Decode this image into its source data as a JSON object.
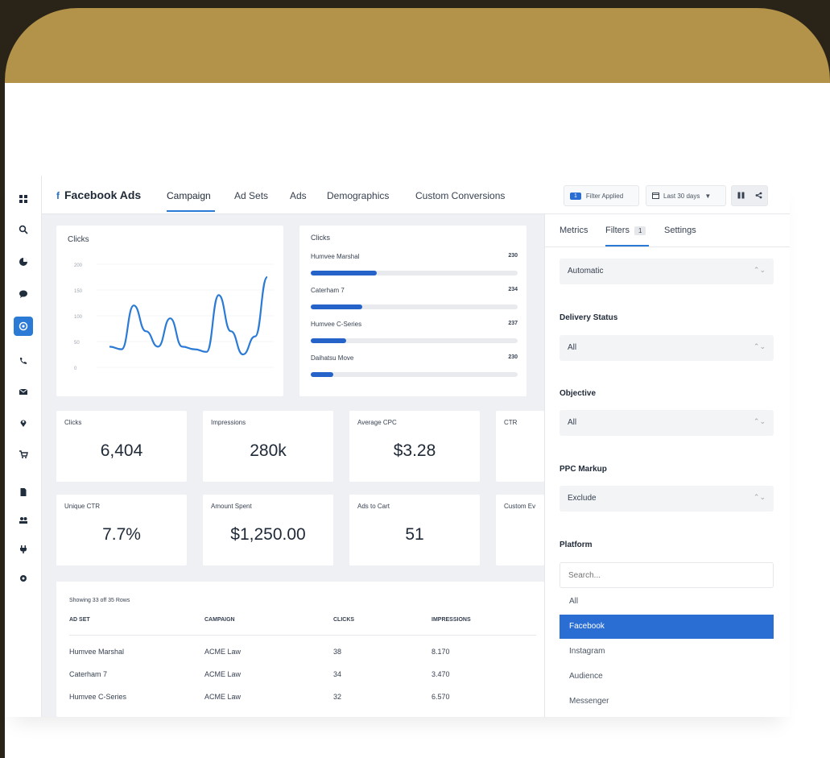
{
  "brand": {
    "name": "Facebook Ads",
    "logo": "f"
  },
  "tabs": [
    "Campaign",
    "Ad Sets",
    "Ads",
    "Demographics",
    "Custom Conversions"
  ],
  "toolbar": {
    "filter_count": "1",
    "filter_label": "Filter Applied",
    "date_range": "Last 30 days"
  },
  "sidebar_icons": [
    "grid-icon",
    "search-icon",
    "pie-chart-icon",
    "chat-icon",
    "target-icon",
    "phone-icon",
    "mail-icon",
    "location-icon",
    "cart-icon",
    "document-icon",
    "users-icon",
    "plug-icon",
    "gear-icon"
  ],
  "line_chart": {
    "title": "Clicks",
    "y_ticks": [
      "200",
      "150",
      "100",
      "50",
      "0"
    ],
    "chart_data": {
      "type": "line",
      "title": "Clicks",
      "ylim": [
        0,
        200
      ],
      "values": [
        40,
        35,
        120,
        70,
        40,
        95,
        40,
        35,
        30,
        140,
        70,
        25,
        60,
        175
      ]
    }
  },
  "bar_chart": {
    "title": "Clicks",
    "chart_data": {
      "type": "bar",
      "categories": [
        "Humvee Marshal",
        "Caterham 7",
        "Humvee C-Series",
        "Daihatsu Move"
      ],
      "values": [
        230,
        234,
        237,
        230
      ],
      "fill_fractions": [
        0.32,
        0.25,
        0.17,
        0.11
      ]
    }
  },
  "kpis": [
    {
      "label": "Clicks",
      "value": "6,404"
    },
    {
      "label": "Impressions",
      "value": "280k"
    },
    {
      "label": "Average CPC",
      "value": "$3.28"
    },
    {
      "label": "CTR",
      "value": ""
    },
    {
      "label": "Unique CTR",
      "value": "7.7%"
    },
    {
      "label": "Amount Spent",
      "value": "$1,250.00"
    },
    {
      "label": "Ads to Cart",
      "value": "51"
    },
    {
      "label": "Custom Ev",
      "value": ""
    }
  ],
  "table": {
    "showing": "Showing 33 off 35 Rows",
    "headers": [
      "AD SET",
      "CAMPAIGN",
      "CLICKS",
      "IMPRESSIONS"
    ],
    "rows": [
      [
        "Humvee Marshal",
        "ACME Law",
        "38",
        "8.170"
      ],
      [
        "Caterham 7",
        "ACME Law",
        "34",
        "3.470"
      ],
      [
        "Humvee C-Series",
        "ACME Law",
        "32",
        "6.570"
      ]
    ]
  },
  "panel": {
    "tabs": [
      "Metrics",
      "Filters",
      "Settings"
    ],
    "filters_badge": "1",
    "top_select": "Automatic",
    "delivery": {
      "label": "Delivery Status",
      "value": "All"
    },
    "objective": {
      "label": "Objective",
      "value": "All"
    },
    "markup": {
      "label": "PPC Markup",
      "value": "Exclude"
    },
    "platform": {
      "label": "Platform",
      "placeholder": "Search...",
      "options": [
        "All",
        "Facebook",
        "Instagram",
        "Audience",
        "Messenger"
      ],
      "selected": "Facebook"
    }
  },
  "colors": {
    "accent": "#2b7bd6",
    "bar": "#2563c9",
    "frame": "#b39249"
  }
}
